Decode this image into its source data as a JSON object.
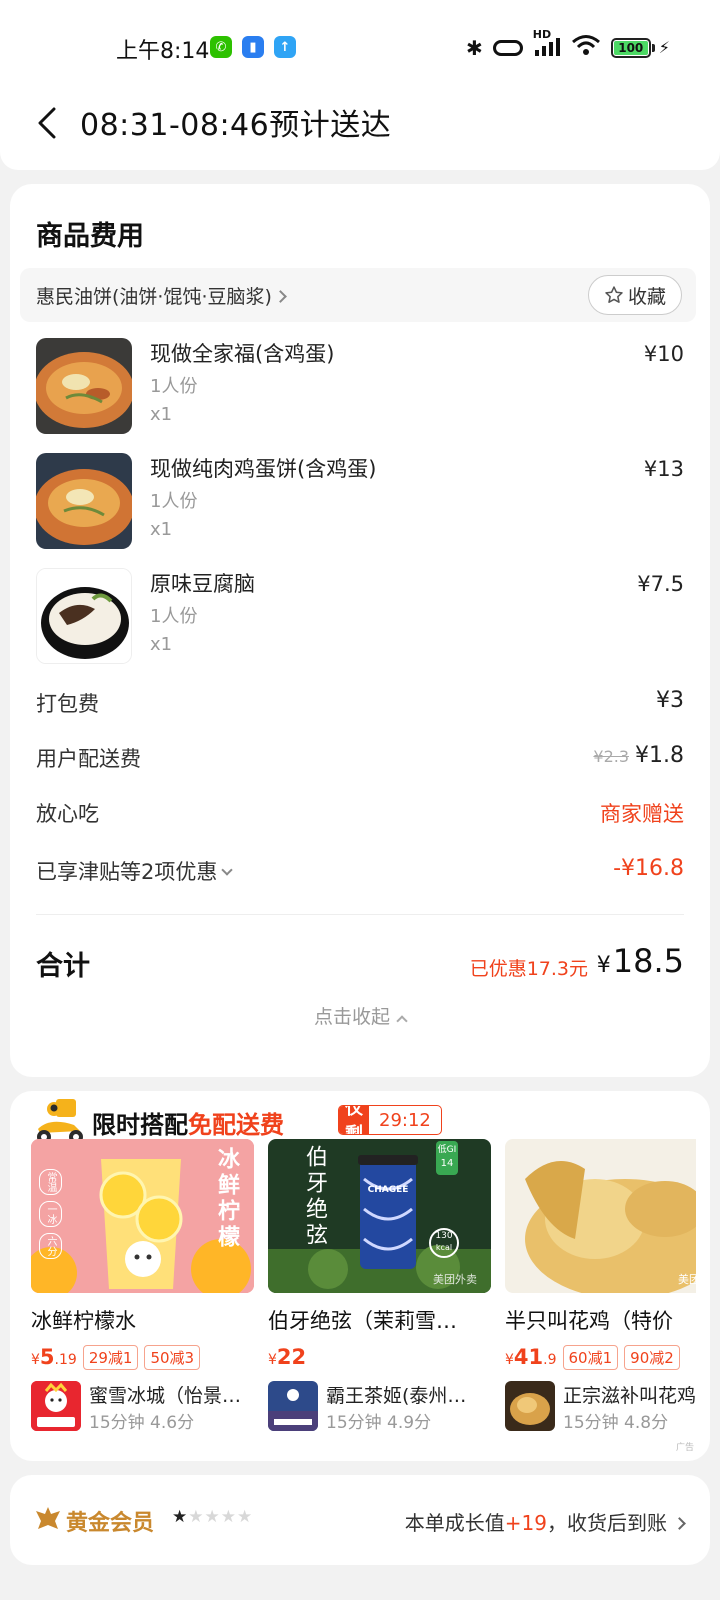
{
  "status_bar": {
    "time": "上午8:14",
    "network_label": "HD",
    "battery": "100"
  },
  "header": {
    "title": "08:31-08:46预计送达"
  },
  "fees": {
    "section_title": "商品费用",
    "shop_name": "惠民油饼(油饼·馄饨·豆脑浆)",
    "favorite_label": "收藏",
    "items": [
      {
        "name": "现做全家福(含鸡蛋)",
        "spec": "1人份",
        "qty": "x1",
        "price": "¥10"
      },
      {
        "name": "现做纯肉鸡蛋饼(含鸡蛋)",
        "spec": "1人份",
        "qty": "x1",
        "price": "¥13"
      },
      {
        "name": "原味豆腐脑",
        "spec": "1人份",
        "qty": "x1",
        "price": "¥7.5"
      }
    ],
    "packing": {
      "label": "打包费",
      "value": "¥3"
    },
    "delivery": {
      "label": "用户配送费",
      "original": "¥2.3",
      "value": "¥1.8"
    },
    "assurance": {
      "label": "放心吃",
      "value": "商家赠送"
    },
    "discount": {
      "label": "已享津贴等2项优惠",
      "value": "-¥16.8"
    },
    "total": {
      "label": "合计",
      "saved": "已优惠17.3元",
      "currency": "¥",
      "amount": "18.5"
    },
    "collapse_label": "点击收起"
  },
  "promo": {
    "title_prefix": "限时搭配",
    "title_highlight": "免配送费",
    "timer_label": "仅剩",
    "timer_value": "29:12",
    "products": [
      {
        "name": "冰鲜柠檬水",
        "price_currency": "¥",
        "price_int": "5",
        "price_dec": ".19",
        "tags": [
          "29减1",
          "50减3"
        ],
        "shop": "蜜雪冰城（怡景…",
        "meta": "15分钟 4.6分",
        "image_text": "冰鲜柠檬",
        "badges": [
          "常温",
          "一冰",
          "六分"
        ]
      },
      {
        "name": "伯牙绝弦（茉莉雪…",
        "price_currency": "¥",
        "price_int": "22",
        "price_dec": "",
        "tags": [],
        "shop": "霸王茶姬(泰州…",
        "meta": "15分钟 4.9分",
        "image_text": "伯牙绝弦",
        "gi_label": "低GI",
        "gi_value": "14",
        "kcal_value": "130",
        "kcal_unit": "kcal",
        "cup_brand": "CHAGEE",
        "watermark": "美团外卖"
      },
      {
        "name": "半只叫花鸡（特价",
        "price_currency": "¥",
        "price_int": "41",
        "price_dec": ".9",
        "tags": [
          "60减1",
          "90减2"
        ],
        "shop": "正宗滋补叫花鸡",
        "meta": "15分钟 4.8分",
        "watermark": "美团外卖"
      }
    ],
    "ad_mark": "广告"
  },
  "member": {
    "level": "黄金会员",
    "stars_filled": 1,
    "stars_total": 5,
    "growth_prefix": "本单成长值",
    "growth_value": "+19",
    "growth_suffix": "，收货后到账"
  },
  "colors": {
    "accent_red": "#f0421c",
    "gold": "#c9882e",
    "background": "#f2f2f2"
  }
}
